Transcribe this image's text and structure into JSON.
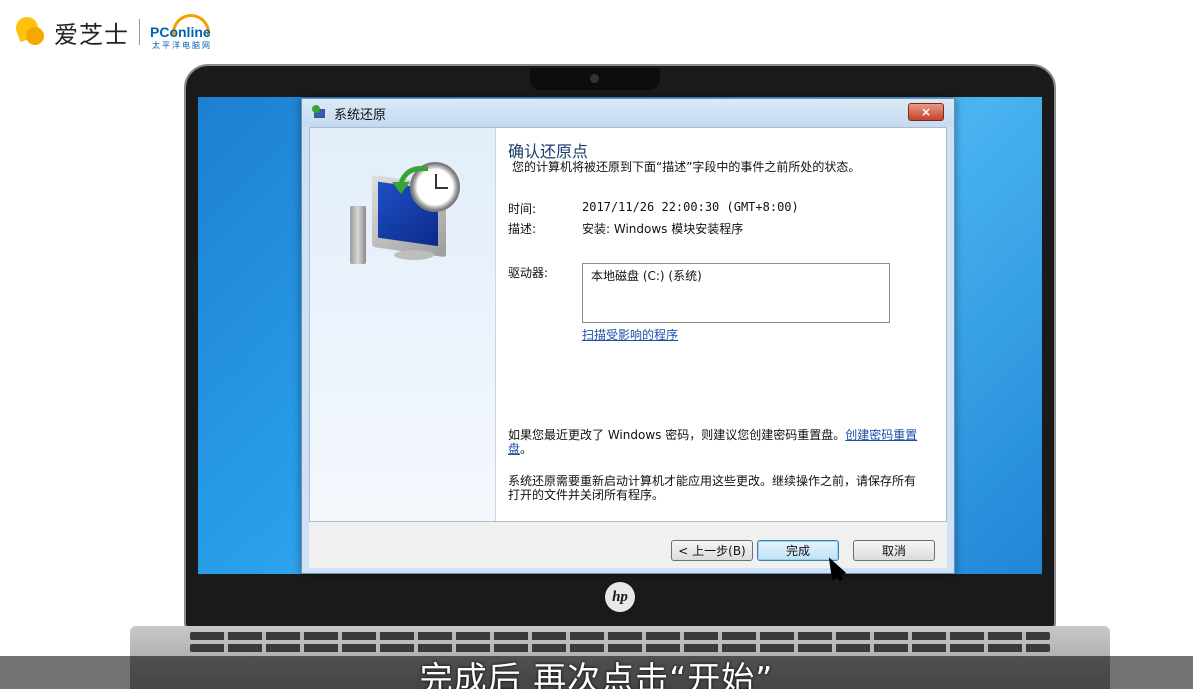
{
  "branding": {
    "aizhishi": "爱芝士",
    "pconline_word": "PConline",
    "pconline_sub": "太平洋电脑网"
  },
  "dialog": {
    "title": "系统还原",
    "close_label": "×",
    "heading": "确认还原点",
    "description": "您的计算机将被还原到下面“描述”字段中的事件之前所处的状态。",
    "time_label": "时间:",
    "time_value": "2017/11/26 22:00:30 (GMT+8:00)",
    "desc_label": "描述:",
    "desc_value": "安装: Windows 模块安装程序",
    "drives_label": "驱动器:",
    "drives": [
      "本地磁盘 (C:) (系统)"
    ],
    "scan_link": "扫描受影响的程序",
    "password_note": "如果您最近更改了 Windows 密码，则建议您创建密码重置盘。",
    "password_link": "创建密码重置盘",
    "password_note_end": "。",
    "restart_note": "系统还原需要重新启动计算机才能应用这些更改。继续操作之前，请保存所有打开的文件并关闭所有程序。",
    "buttons": {
      "back": "< 上一步(B)",
      "finish": "完成",
      "cancel": "取消"
    }
  },
  "laptop": {
    "brand": "hp"
  },
  "subtitle": "完成后 再次点击“开始”"
}
